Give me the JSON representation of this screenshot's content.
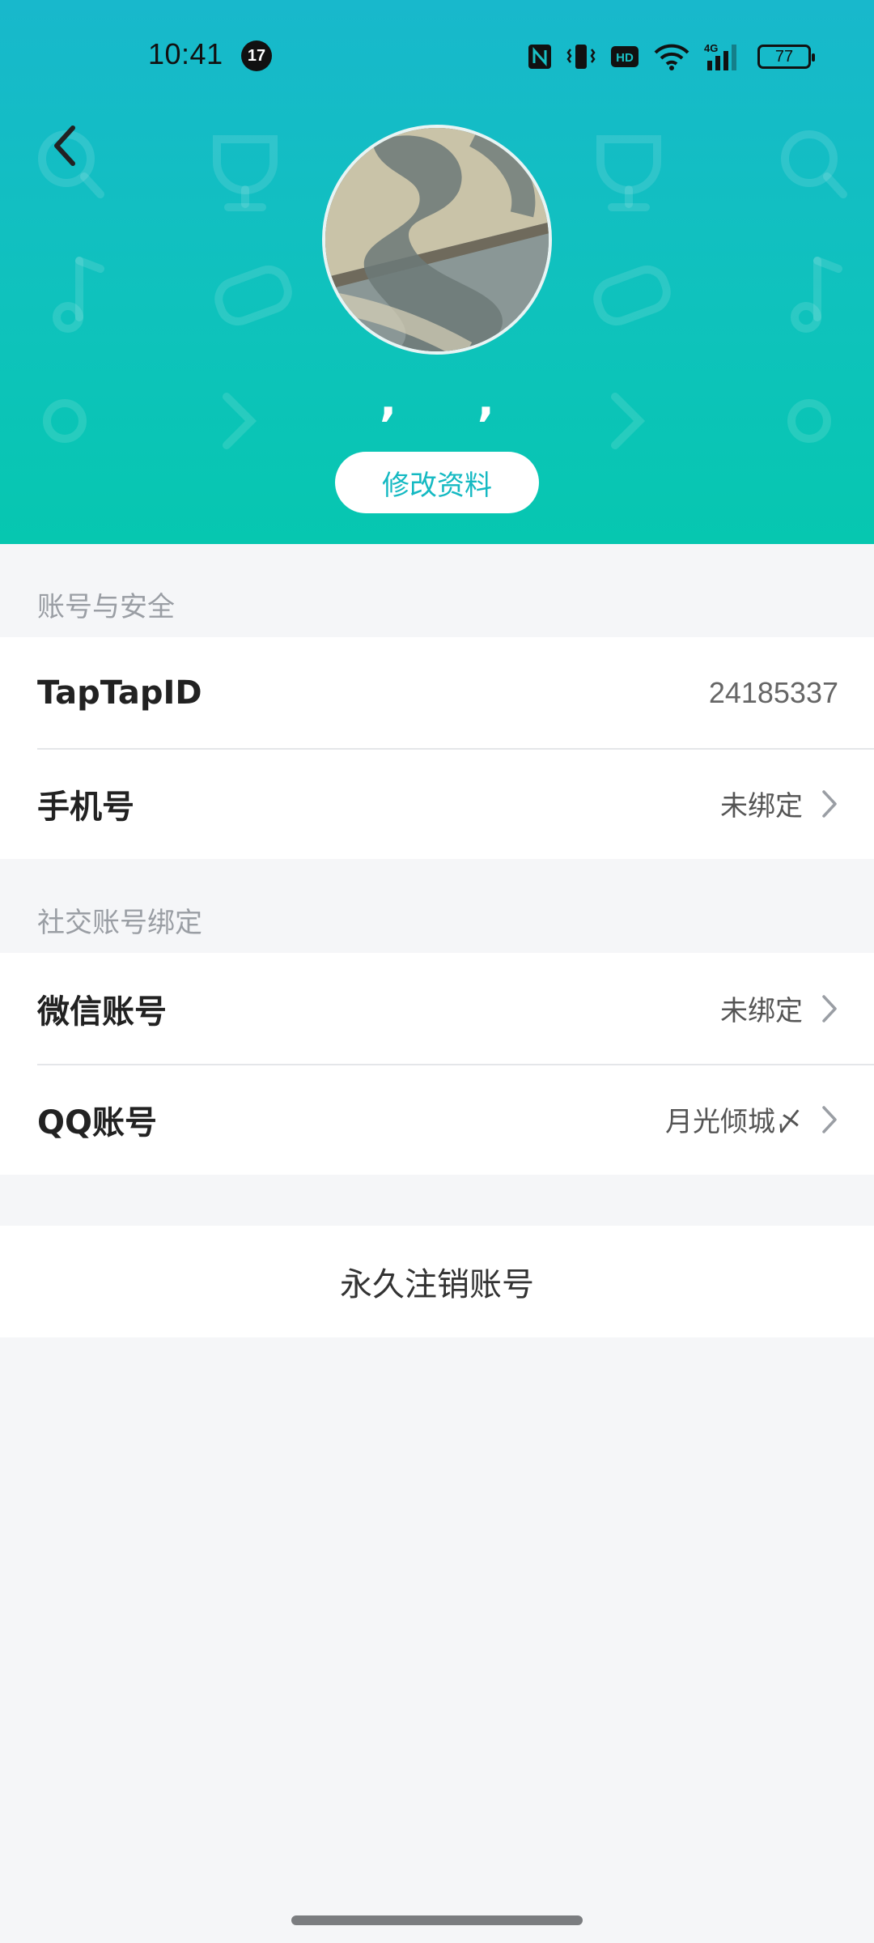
{
  "status_bar": {
    "time": "10:41",
    "notification_count": "17",
    "battery": "77",
    "network": "4G",
    "hd": "HD"
  },
  "profile": {
    "nickname": ", ,",
    "edit_button": "修改资料"
  },
  "sections": {
    "account_security": {
      "title": "账号与安全",
      "taptap_id_label": "TapTapID",
      "taptap_id_value": "24185337",
      "phone_label": "手机号",
      "phone_value": "未绑定"
    },
    "social_binding": {
      "title": "社交账号绑定",
      "wechat_label": "微信账号",
      "wechat_value": "未绑定",
      "qq_label": "QQ账号",
      "qq_value": "月光倾城〆"
    }
  },
  "delete_account": {
    "label": "永久注销账号"
  },
  "icons": [
    "back-arrow-icon",
    "chevron-right-icon",
    "nfc-icon",
    "vibrate-icon",
    "hd-icon",
    "wifi-icon",
    "signal-icon",
    "battery-icon"
  ],
  "colors": {
    "header_top": "#18b8cc",
    "header_bottom": "#06c7b0",
    "accent": "#14b9c2",
    "page_bg": "#f5f6f8"
  }
}
